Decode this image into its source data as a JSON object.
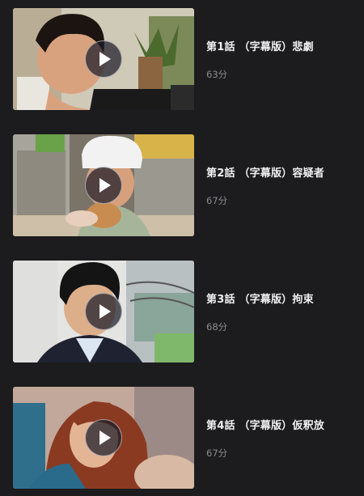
{
  "episodes": [
    {
      "title": "第1話 （字幕版）悲劇",
      "duration": "63分",
      "thumb_icon": "man-portrait-thumbnail"
    },
    {
      "title": "第2話 （字幕版）容疑者",
      "duration": "67分",
      "thumb_icon": "bakery-woman-thumbnail"
    },
    {
      "title": "第3話 （字幕版）拘束",
      "duration": "68分",
      "thumb_icon": "man-in-suit-thumbnail"
    },
    {
      "title": "第4話 （字幕版）仮釈放",
      "duration": "67分",
      "thumb_icon": "smiling-woman-thumbnail"
    }
  ],
  "colors": {
    "background": "#1c1c1f",
    "title": "#f0f0f2",
    "duration": "#8a8b90"
  }
}
